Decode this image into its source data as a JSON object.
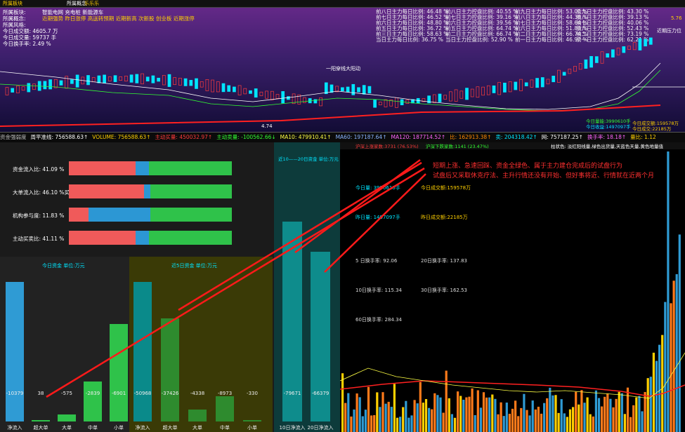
{
  "top_header": {
    "left_title": "所属板块",
    "mid_label": "所属概念",
    "hint": "乐乐乐"
  },
  "top_left_labels": [
    {
      "text": "所属板块:",
      "color": "#ffffff"
    },
    {
      "text": "所属概念:",
      "color": "#ffffff"
    },
    {
      "text": "所属风格:",
      "color": "#ffffff"
    },
    {
      "text": "今日成交额: 4605.7 万",
      "color": "#ffffff"
    },
    {
      "text": "今日成交量: 59737 手",
      "color": "#ffffff"
    },
    {
      "text": "今日换手率: 2.49 %",
      "color": "#ffffff"
    }
  ],
  "top_concepts": [
    "智能电网 充电桩 新能源车",
    "近期强势 昨日涨停 高送转预期 近期新高 次新股 创业板 近期涨停"
  ],
  "top_right_rows": [
    [
      "前八日主力每日比例: 46.48 %",
      "前八日主力控盘比例: 40.55 %",
      "前九日主力每日比例: 53.01 %",
      "前九日主力控盘比例: 43.30 %"
    ],
    [
      "前七日主力每日比例: 46.52 %",
      "前七日主力控盘比例: 39.16 %",
      "前八日主力每日比例: 44.38 %",
      "前八日主力控盘比例: 39.13 %"
    ],
    [
      "前六日主力每日比例: 48.80 %",
      "前六日主力控盘比例: 39.56 %",
      "前七日主力每日比例: 58.64 %",
      "前七日主力控盘比例: 40.06 %"
    ],
    [
      "前五日主力每日比例: 36.72 %",
      "前五日主力控盘比例: 64.74 %",
      "前六日主力每日比例: 51.83 %",
      "前六日主力控盘比例: 52.43 %"
    ],
    [
      "前三日主力每日比例: 58.63 %",
      "前二日主力控盘比例: 66.74 %",
      "前二日主力每日比例: 66.74 %",
      "前二日主力控盘比例: 73.19 %"
    ],
    [
      "当日主力每日比例: 36.75 %",
      "当日主力控盘比例: 52.90 %",
      "前一日主力每日比例: 46.97 %",
      "前一日主力控盘比例: 62.21 %"
    ]
  ],
  "chart_overlays": {
    "annotation1": "一阳穿线大阳动",
    "annotation2": "近期压力位",
    "annotation3": "今日量能:3990610手",
    "annotation4": "今日成交额:159578万",
    "annotation5": "今日收益:1497097手",
    "annotation6": "今日成交:22185万",
    "corner": "5.76",
    "price_low": "4.74"
  },
  "strip": [
    {
      "text": "资金强弱度",
      "color": "#bbbbbb"
    },
    {
      "text": "周平准线: 756588.63↑",
      "color": "#ffffff"
    },
    {
      "text": "VOLUME: 756588.63↑",
      "color": "#ffd000"
    },
    {
      "text": "主动买量: 450032.97↑",
      "color": "#ff3b3b"
    },
    {
      "text": "主动卖量: -100562.66↓",
      "color": "#32ff32"
    },
    {
      "text": "MA10: 479910.41↑",
      "color": "#ffff44"
    },
    {
      "text": "MA60: 197187.64↑",
      "color": "#8ab4ff"
    },
    {
      "text": "MA120: 187714.52↑",
      "color": "#ff66ff"
    },
    {
      "text": "比: 162913.38↑",
      "color": "#ff8a00"
    },
    {
      "text": "卖: 204318.42↑",
      "color": "#00e5ff"
    },
    {
      "text": "网: 757187.25↑",
      "color": "#ffffff"
    },
    {
      "text": "换手率: 18.18↑",
      "color": "#ff66ff"
    },
    {
      "text": "量比: 1.12",
      "color": "#ffd000"
    }
  ],
  "ratios": [
    {
      "label": "资金流入比: 41.09 %",
      "red": 0.41,
      "blue": 0.08
    },
    {
      "label": "大单流入比: 46.10 %买",
      "red": 0.46,
      "blue": 0.04
    },
    {
      "label": "机构参与度: 11.83 %",
      "red": 0.12,
      "blue": 0.38
    },
    {
      "label": "主动买卖比: 41.11 %",
      "red": 0.41,
      "blue": 0.08
    }
  ],
  "panel_titles": {
    "today": "今日资金  单位:万元",
    "five": "近5日资金  单位:万元",
    "ten": "近10——20日资金  单位:万元"
  },
  "today_bars": [
    {
      "label": "净流入",
      "value": "-10379",
      "color": "#2f9bd4",
      "h": 0.95
    },
    {
      "label": "超大单",
      "value": "38",
      "color": "#2fc24a",
      "h": 0.01
    },
    {
      "label": "大单",
      "value": "-575",
      "color": "#2fc24a",
      "h": 0.05
    },
    {
      "label": "中单",
      "value": "-2839",
      "color": "#2fc24a",
      "h": 0.27
    },
    {
      "label": "小单",
      "value": "-6901",
      "color": "#2fc24a",
      "h": 0.66
    }
  ],
  "five_bars": [
    {
      "label": "净流入",
      "value": "-50968",
      "color": "#0a8a8a",
      "h": 0.95
    },
    {
      "label": "超大单",
      "value": "-37426",
      "color": "#2e8b2e",
      "h": 0.7
    },
    {
      "label": "大单",
      "value": "-4338",
      "color": "#2e8b2e",
      "h": 0.08
    },
    {
      "label": "中单",
      "value": "-8973",
      "color": "#2e8b2e",
      "h": 0.17
    },
    {
      "label": "小单",
      "value": "-330",
      "color": "#2e8b2e",
      "h": 0.01
    }
  ],
  "ten_bars": [
    {
      "label": "10日净流入",
      "value": "-79671",
      "color": "#0e8c8c",
      "h": 0.92
    },
    {
      "label": "20日净流入",
      "value": "-66379",
      "color": "#0e8c8c",
      "h": 0.78
    }
  ],
  "right_header": {
    "a": "沪深上涨家数:3731 (76.53%)",
    "b": "沪深下跌家数:1141 (23.47%)",
    "c": "柱状色: 淡红阳线量,绿色出货量,天蓝色天量,黄色地量值"
  },
  "annotation": {
    "line1": "短期上涨、急速回踩、资金全绿色、属于主力建仓完成后的试盘行为",
    "line2": "试盘后又采取休克疗法、主升行情还没有开始、但好事将近、行情就在近两个月"
  },
  "right_stats": [
    {
      "text": "今日量: 3990610手",
      "color": "#00e5ff"
    },
    {
      "text": "今日成交额:159578万",
      "color": "#ffd000"
    },
    {
      "text": "昨日量: 1497097手",
      "color": "#00e5ff"
    },
    {
      "text": "昨日成交额:22185万",
      "color": "#ffd000"
    },
    {
      "text": "5 日换手率:  92.06",
      "color": "#dddddd"
    },
    {
      "text": "20日换手率:  137.83",
      "color": "#dddddd"
    },
    {
      "text": "10日换手率:  115.34",
      "color": "#dddddd"
    },
    {
      "text": "30日换手率:  162.53",
      "color": "#dddddd"
    },
    {
      "text": "60日换手率:  284.34",
      "color": "#dddddd"
    }
  ]
}
